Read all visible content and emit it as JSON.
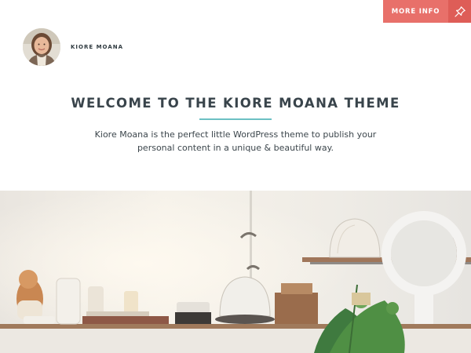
{
  "topbar": {
    "more_info_label": "MORE INFO",
    "pin_icon": "pin-icon",
    "accent": "#e8706a",
    "accent_dark": "#de5d57"
  },
  "header": {
    "site_title": "KIORE MOANA",
    "avatar_icon": "avatar"
  },
  "welcome": {
    "title": "WELCOME TO THE KIORE MOANA THEME",
    "text": "Kiore Moana is the perfect little WordPress theme to publish your personal content in a unique & beautiful way.",
    "rule_color": "#6cc0c3"
  },
  "hero": {
    "description_icon": "kitchen-shelf-photo"
  }
}
